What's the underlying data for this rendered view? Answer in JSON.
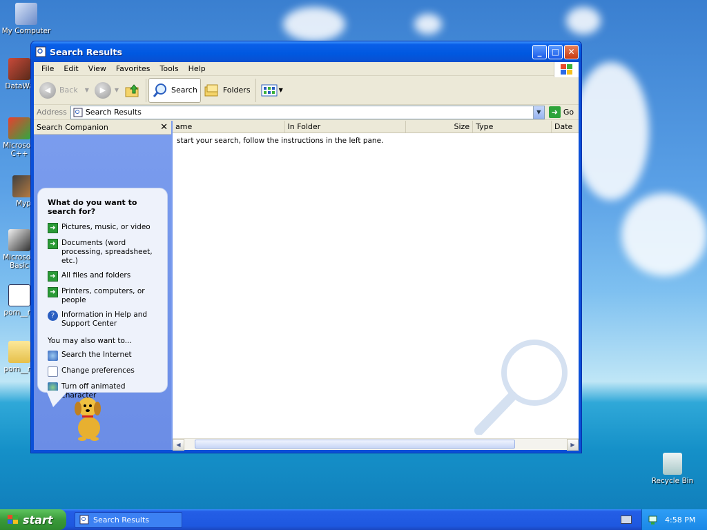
{
  "desktop": {
    "icons": [
      {
        "label": "My Computer"
      },
      {
        "label": "DataWa"
      },
      {
        "label": "Microsoft C++"
      },
      {
        "label": "Myp"
      },
      {
        "label": "Microsoft Basic"
      },
      {
        "label": "porn__ra"
      },
      {
        "label": "porn__ra"
      },
      {
        "label": "Recycle Bin"
      }
    ]
  },
  "window": {
    "title": "Search Results",
    "menu": [
      "File",
      "Edit",
      "View",
      "Favorites",
      "Tools",
      "Help"
    ],
    "toolbar": {
      "back": "Back",
      "search": "Search",
      "folders": "Folders"
    },
    "address": {
      "label": "Address",
      "value": "Search Results",
      "go": "Go"
    },
    "companion": {
      "header": "Search Companion",
      "question": "What do you want to search for?",
      "options": [
        "Pictures, music, or video",
        "Documents (word processing, spreadsheet, etc.)",
        "All files and folders",
        "Printers, computers, or people",
        "Information in Help and Support Center"
      ],
      "also_label": "You may also want to...",
      "also": [
        "Search the Internet",
        "Change preferences",
        "Turn off animated character"
      ]
    },
    "results": {
      "columns": [
        "ame",
        "In Folder",
        "Size",
        "Type",
        "Date"
      ],
      "message": "start your search, follow the instructions in the left pane."
    }
  },
  "taskbar": {
    "start": "start",
    "task": "Search Results",
    "clock": "4:58 PM"
  }
}
